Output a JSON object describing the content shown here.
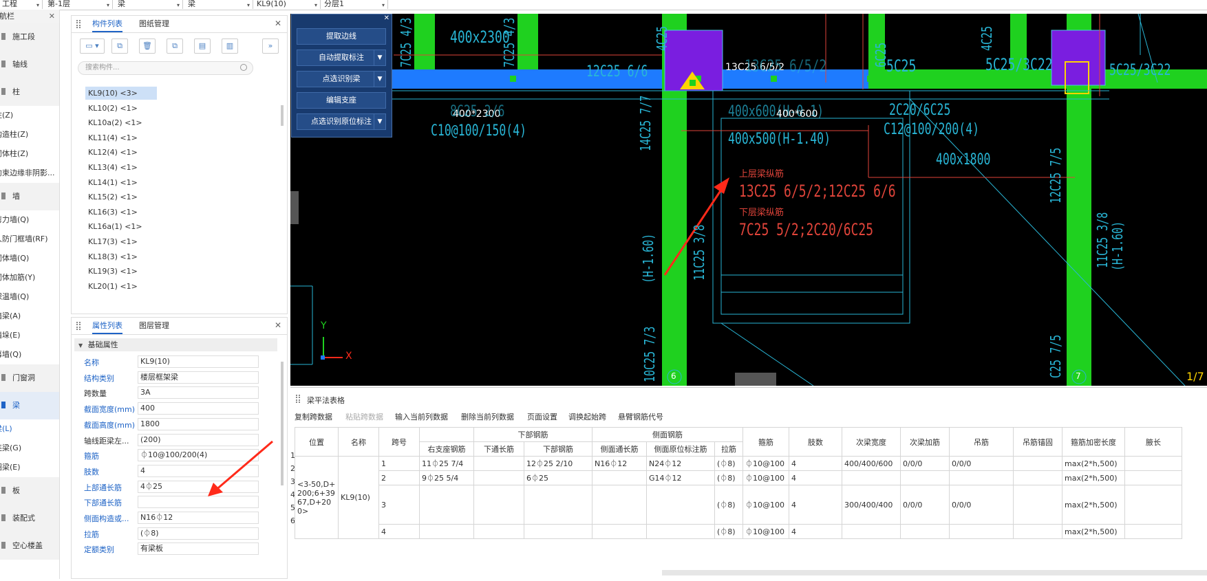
{
  "topbar": {
    "selects": [
      {
        "label": "工程"
      },
      {
        "label": "第-1层"
      },
      {
        "label": "梁"
      },
      {
        "label": "梁"
      },
      {
        "label": "KL9(10)"
      },
      {
        "label": "分层1"
      }
    ]
  },
  "leftnav": {
    "title": "导航栏",
    "items": [
      {
        "type": "group",
        "label": "施工段"
      },
      {
        "type": "group",
        "label": "轴线"
      },
      {
        "type": "group",
        "label": "柱"
      },
      {
        "type": "item",
        "label": "柱(Z)"
      },
      {
        "type": "item",
        "label": "构造柱(Z)"
      },
      {
        "type": "item",
        "label": "砌体柱(Z)"
      },
      {
        "type": "item",
        "label": "约束边缘非阴影..."
      },
      {
        "type": "group",
        "label": "墙"
      },
      {
        "type": "item",
        "label": "剪力墙(Q)"
      },
      {
        "type": "item",
        "label": "人防门框墙(RF)"
      },
      {
        "type": "item",
        "label": "砌体墙(Q)"
      },
      {
        "type": "item",
        "label": "砌体加筋(Y)"
      },
      {
        "type": "item",
        "label": "保温墙(Q)"
      },
      {
        "type": "item",
        "label": "暗梁(A)"
      },
      {
        "type": "item",
        "label": "墙垛(E)"
      },
      {
        "type": "item",
        "label": "幕墙(Q)"
      },
      {
        "type": "group",
        "label": "门窗洞"
      },
      {
        "type": "group",
        "label": "梁",
        "selected": true
      },
      {
        "type": "item",
        "label": "梁(L)",
        "selected": true
      },
      {
        "type": "item",
        "label": "连梁(G)"
      },
      {
        "type": "item",
        "label": "圈梁(E)"
      },
      {
        "type": "group",
        "label": "板"
      },
      {
        "type": "group",
        "label": "装配式"
      },
      {
        "type": "group",
        "label": "空心楼盖"
      }
    ]
  },
  "comp_panel": {
    "tabs": [
      "构件列表",
      "图纸管理"
    ],
    "search_placeholder": "搜索构件...",
    "items": [
      "KL9(10) <3>",
      "KL10(2) <1>",
      "KL10a(2) <1>",
      "KL11(4) <1>",
      "KL12(4) <1>",
      "KL13(4) <1>",
      "KL14(1) <1>",
      "KL15(2) <1>",
      "KL16(3) <1>",
      "KL16a(1) <1>",
      "KL17(3) <1>",
      "KL18(3) <1>",
      "KL19(3) <1>",
      "KL20(1) <1>"
    ]
  },
  "prop_panel": {
    "tabs": [
      "属性列表",
      "图层管理"
    ],
    "section": "基础属性",
    "rows": [
      {
        "label": "名称",
        "value": "KL9(10)",
        "blue": true
      },
      {
        "label": "结构类别",
        "value": "楼层框架梁",
        "blue": true
      },
      {
        "label": "跨数量",
        "value": "3A",
        "blue": false
      },
      {
        "label": "截面宽度(mm)",
        "value": "400",
        "blue": true
      },
      {
        "label": "截面高度(mm)",
        "value": "1800",
        "blue": true
      },
      {
        "label": "轴线距梁左...",
        "value": "(200)",
        "blue": false
      },
      {
        "label": "箍筋",
        "value": "⏀10@100/200(4)",
        "blue": true
      },
      {
        "label": "肢数",
        "value": "4",
        "blue": true
      },
      {
        "label": "上部通长筋",
        "value": "4⏀25",
        "blue": true
      },
      {
        "label": "下部通长筋",
        "value": "",
        "blue": true
      },
      {
        "label": "侧面构造或...",
        "value": "N16⏀12",
        "blue": true
      },
      {
        "label": "拉筋",
        "value": "(⏀8)",
        "blue": true
      },
      {
        "label": "定额类别",
        "value": "有梁板",
        "blue": true
      }
    ]
  },
  "dialog": {
    "buttons": [
      {
        "label": "提取边线",
        "dropdown": false
      },
      {
        "label": "自动提取标注",
        "dropdown": true
      },
      {
        "label": "点选识别梁",
        "dropdown": true
      },
      {
        "label": "编辑支座",
        "dropdown": false
      },
      {
        "label": "点选识别原位标注",
        "dropdown": true
      }
    ]
  },
  "cad": {
    "labels": {
      "t1": "400x2300",
      "t2": "12C25 6/6",
      "t3": "13C25 6/5/2",
      "t4": "13C25 6/5/2",
      "t5": "5C25",
      "t6": "5C25/3C22",
      "t7": "5C25/3C22",
      "t8": "400*2300",
      "t9": "8C25 2/6",
      "t10": "C10@100/150(4)",
      "t11": "400x600(H-0.1)",
      "t12": "400*600",
      "t13": "400x500(H-1.40)",
      "t14": "2C20/6C25",
      "t15": "C12@100/200(4)",
      "t16": "400x1800",
      "t17": "上层梁纵筋",
      "t18": "13C25 6/5/2;12C25 6/6",
      "t19": "下层梁纵筋",
      "t20": "7C25 5/2;2C20/6C25",
      "t21": "14C25 7/7",
      "t22": "(H-1.60)",
      "t23": "11C25 3/8",
      "t24": "10C25 7/3",
      "t25": "12C25 7/5",
      "t26": "11C25 3/8",
      "t27": "(H-1.60)",
      "t28": "C25 7/5",
      "t29": "1/7",
      "axis6": "6",
      "axis7": "7",
      "axisx": "X",
      "axisy": "Y",
      "v1": "7C25 4/3",
      "v2": "7C25 4/3",
      "v3": "4C25",
      "v4": "6C25",
      "v5": "4C25"
    }
  },
  "bottom": {
    "title": "梁平法表格",
    "buttons": [
      "复制跨数据",
      "粘贴跨数据",
      "输入当前列数据",
      "删除当前列数据",
      "页面设置",
      "调换起始跨",
      "悬臂钢筋代号"
    ],
    "disabled_buttons": [
      "粘贴跨数据"
    ],
    "header_top": {
      "position": "位置",
      "name": "名称",
      "span": "跨号",
      "bottom_rebar": "下部钢筋",
      "side_rebar": "侧面钢筋",
      "stirrup": "箍筋",
      "legs": "肢数",
      "sub_width": "次梁宽度",
      "sub_add": "次梁加筋",
      "hanger": "吊筋",
      "hanger_anchor": "吊筋锚固",
      "dense_len": "箍筋加密长度",
      "haunch": "腋长"
    },
    "header_sub": [
      "右支座钢筋",
      "下通长筋",
      "下部钢筋",
      "侧面通长筋",
      "侧面原位标注筋",
      "拉筋"
    ],
    "position_text": "<3-50,D+200;6+3967,D+200>",
    "name_text": "KL9(10)",
    "row_numbers": [
      "1",
      "2",
      "3",
      "4",
      "5",
      "6"
    ],
    "rows": [
      {
        "span": "1",
        "right": "11⏀25 7/4",
        "bot_thru": "",
        "bot": "12⏀25 2/10",
        "side_thru": "N16⏀12",
        "side_loc": "N24⏀12",
        "tie": "(⏀8)",
        "stirrup": "⏀10@100",
        "legs": "4",
        "sub_w": "400/400/600",
        "sub_add": "0/0/0",
        "hanger": "0/0/0",
        "anchor": "",
        "dense": "max(2*h,500)",
        "haunch": ""
      },
      {
        "span": "2",
        "right": "9⏀25 5/4",
        "bot_thru": "",
        "bot": "6⏀25",
        "side_thru": "",
        "side_loc": "G14⏀12",
        "tie": "(⏀8)",
        "stirrup": "⏀10@100",
        "legs": "4",
        "sub_w": "",
        "sub_add": "",
        "hanger": "",
        "anchor": "",
        "dense": "max(2*h,500)",
        "haunch": ""
      },
      {
        "span": "3",
        "right": "",
        "bot_thru": "",
        "bot": "",
        "side_thru": "",
        "side_loc": "",
        "tie": "(⏀8)",
        "stirrup": "⏀10@100",
        "legs": "4",
        "sub_w": "300/400/400",
        "sub_add": "0/0/0",
        "hanger": "0/0/0",
        "anchor": "",
        "dense": "max(2*h,500)",
        "haunch": ""
      },
      {
        "span": "4",
        "right": "",
        "bot_thru": "",
        "bot": "",
        "side_thru": "",
        "side_loc": "",
        "tie": "(⏀8)",
        "stirrup": "⏀10@100",
        "legs": "4",
        "sub_w": "",
        "sub_add": "",
        "hanger": "",
        "anchor": "",
        "dense": "max(2*h,500)",
        "haunch": ""
      }
    ]
  }
}
